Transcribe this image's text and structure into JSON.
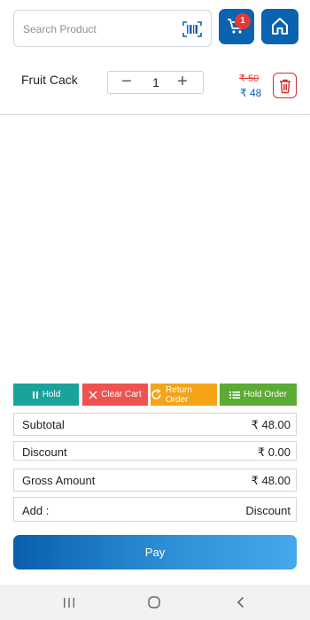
{
  "search": {
    "placeholder": "Search Product",
    "value": ""
  },
  "header": {
    "cart_count": "1"
  },
  "cart": {
    "items": [
      {
        "name": "Fruit Cack",
        "quantity": "1",
        "old_price": "₹ 50",
        "price": "₹ 48"
      }
    ]
  },
  "actions": {
    "hold": "Hold",
    "clear_cart": "Clear Cart",
    "return_order": "Return Order",
    "hold_order": "Hold Order"
  },
  "summary": {
    "subtotal_label": "Subtotal",
    "subtotal_value": "₹ 48.00",
    "discount_label": "Discount",
    "discount_value": "₹ 0.00",
    "gross_label": "Gross Amount",
    "gross_value": "₹ 48.00",
    "add_label": "Add :",
    "add_value": "Discount"
  },
  "pay": {
    "label": "Pay"
  },
  "colors": {
    "primary": "#0a63b1",
    "hold": "#1aa39a",
    "clear": "#ef5350",
    "return": "#f5a417",
    "hold_order": "#5bab35",
    "badge": "#e53935"
  },
  "icons": [
    "barcode-icon",
    "cart-icon",
    "home-icon",
    "trash-icon",
    "pause-icon",
    "close-icon",
    "refresh-icon",
    "list-icon"
  ]
}
